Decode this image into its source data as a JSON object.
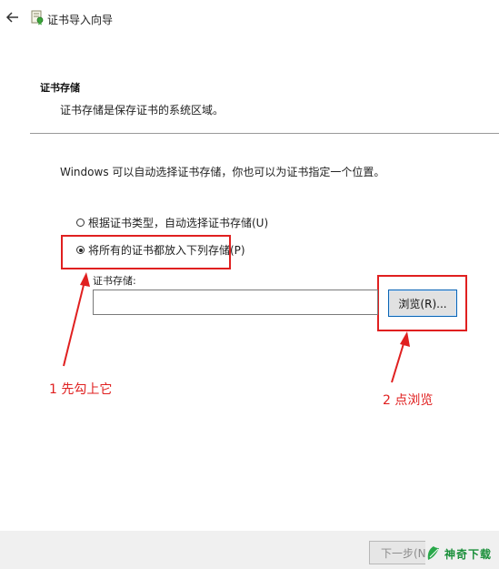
{
  "window": {
    "title": "证书导入向导"
  },
  "section": {
    "title": "证书存储",
    "description": "证书存储是保存证书的系统区域。"
  },
  "main": {
    "intro": "Windows 可以自动选择证书存储，你也可以为证书指定一个位置。",
    "option_auto": "根据证书类型，自动选择证书存储(U)",
    "option_manual": "将所有的证书都放入下列存储(P)",
    "option_selected": "manual",
    "store_label": "证书存储:",
    "store_value": "",
    "browse_label": "浏览(R)..."
  },
  "annotations": {
    "step1": "1 先勾上它",
    "step2": "2 点浏览",
    "color": "#e02020"
  },
  "footer": {
    "next_label": "下一步(N)"
  },
  "watermark": {
    "text": "神奇下载"
  },
  "colors": {
    "accent": "#0a64b4",
    "annotation_red": "#e02020",
    "footer_bg": "#f0f0f0",
    "watermark_green": "#1a8f3a"
  }
}
